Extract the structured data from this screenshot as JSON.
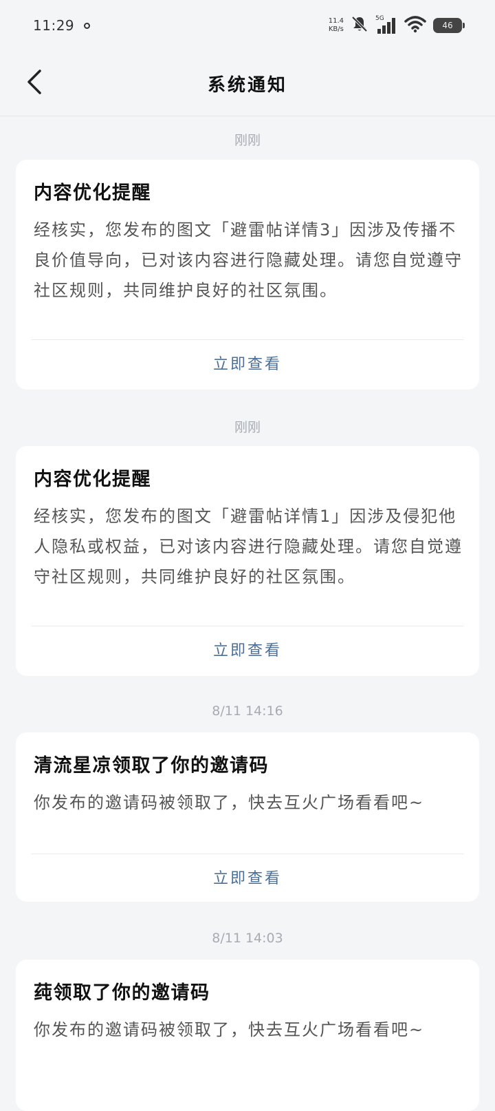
{
  "status_bar": {
    "time": "11:29",
    "net_speed_value": "11.4",
    "net_speed_unit": "KB/s",
    "network_type": "5G",
    "battery": "46",
    "icons": [
      "ring-icon",
      "bell-off-icon",
      "signal-icon",
      "wifi-icon",
      "battery-icon"
    ]
  },
  "header": {
    "title": "系统通知",
    "back_icon": "chevron-left-icon"
  },
  "notifications": [
    {
      "time": "刚刚",
      "title": "内容优化提醒",
      "body": "经核实，您发布的图文「避雷帖详情3」因涉及传播不良价值导向，已对该内容进行隐藏处理。请您自觉遵守社区规则，共同维护良好的社区氛围。",
      "action": "立即查看"
    },
    {
      "time": "刚刚",
      "title": "内容优化提醒",
      "body": "经核实，您发布的图文「避雷帖详情1」因涉及侵犯他人隐私或权益，已对该内容进行隐藏处理。请您自觉遵守社区规则，共同维护良好的社区氛围。",
      "action": "立即查看"
    },
    {
      "time": "8/11 14:16",
      "title": "清流星凉领取了你的邀请码",
      "body": "你发布的邀请码被领取了，快去互火广场看看吧~",
      "action": "立即查看"
    },
    {
      "time": "8/11 14:03",
      "title": "莼领取了你的邀请码",
      "body": "你发布的邀请码被领取了，快去互火广场看看吧~",
      "action": ""
    }
  ],
  "colors": {
    "background": "#f4f5f7",
    "card": "#ffffff",
    "accent_link": "#4a6f98",
    "time_label": "#a7abb3"
  }
}
